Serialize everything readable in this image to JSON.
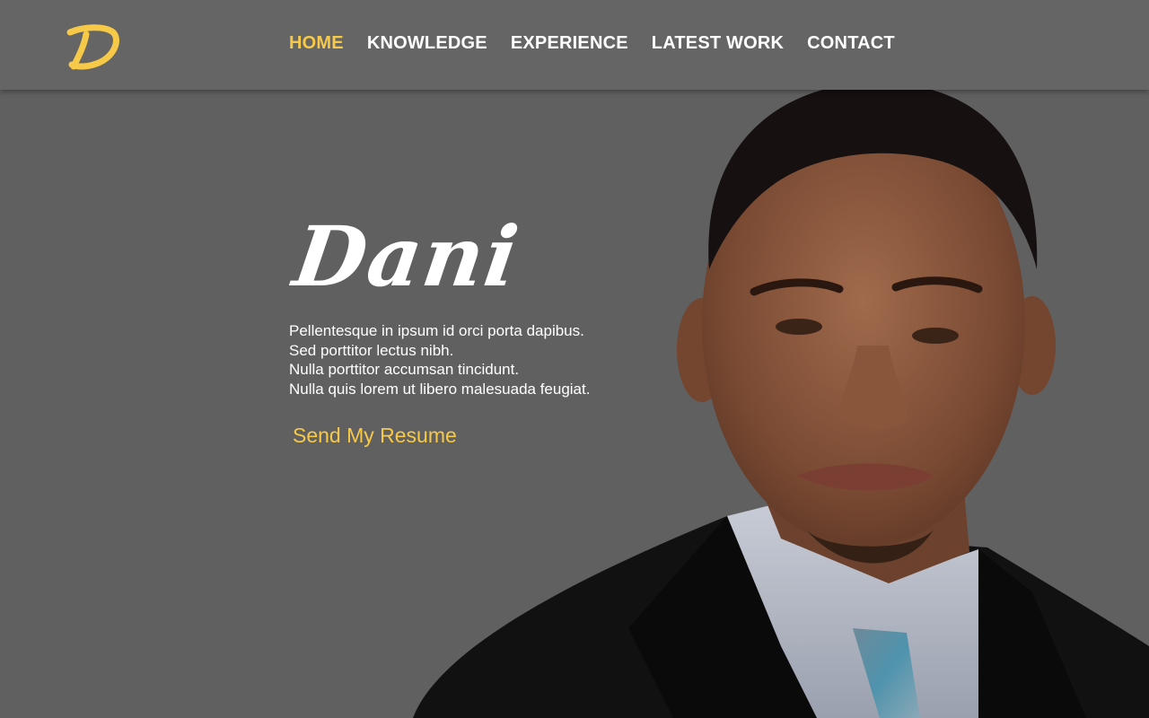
{
  "brand": {
    "logo_letter": "D",
    "accent_color": "#f7c948"
  },
  "nav": {
    "items": [
      {
        "label": "HOME",
        "active": true
      },
      {
        "label": "KNOWLEDGE",
        "active": false
      },
      {
        "label": "EXPERIENCE",
        "active": false
      },
      {
        "label": "LATEST WORK",
        "active": false
      },
      {
        "label": "CONTACT",
        "active": false
      }
    ]
  },
  "hero": {
    "name": "Dani",
    "lines": [
      "Pellentesque in ipsum id orci porta dapibus.",
      "Sed porttitor lectus nibh.",
      "Nulla porttitor accumsan tincidunt.",
      "Nulla quis lorem ut libero malesuada feugiat."
    ],
    "cta_label": "Send My Resume"
  },
  "colors": {
    "background": "#606060",
    "header": "#656565",
    "text": "#ffffff",
    "accent": "#f7c948"
  }
}
